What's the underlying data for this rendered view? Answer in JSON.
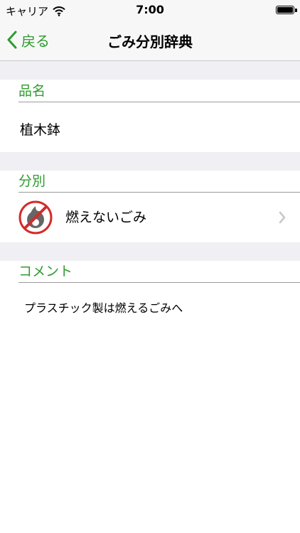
{
  "status": {
    "carrier": "キャリア",
    "time": "7:00"
  },
  "nav": {
    "back_label": "戻る",
    "title": "ごみ分別辞典"
  },
  "item": {
    "header": "品名",
    "name": "植木鉢"
  },
  "category": {
    "header": "分別",
    "value": "燃えないごみ",
    "icon": "no-burn-icon"
  },
  "comment": {
    "header": "コメント",
    "text": "プラスチック製は燃えるごみへ"
  },
  "colors": {
    "accent": "#2e9b2e",
    "separator_bg": "#efeff4",
    "icon_red": "#d42a2a",
    "icon_gray": "#666666"
  }
}
